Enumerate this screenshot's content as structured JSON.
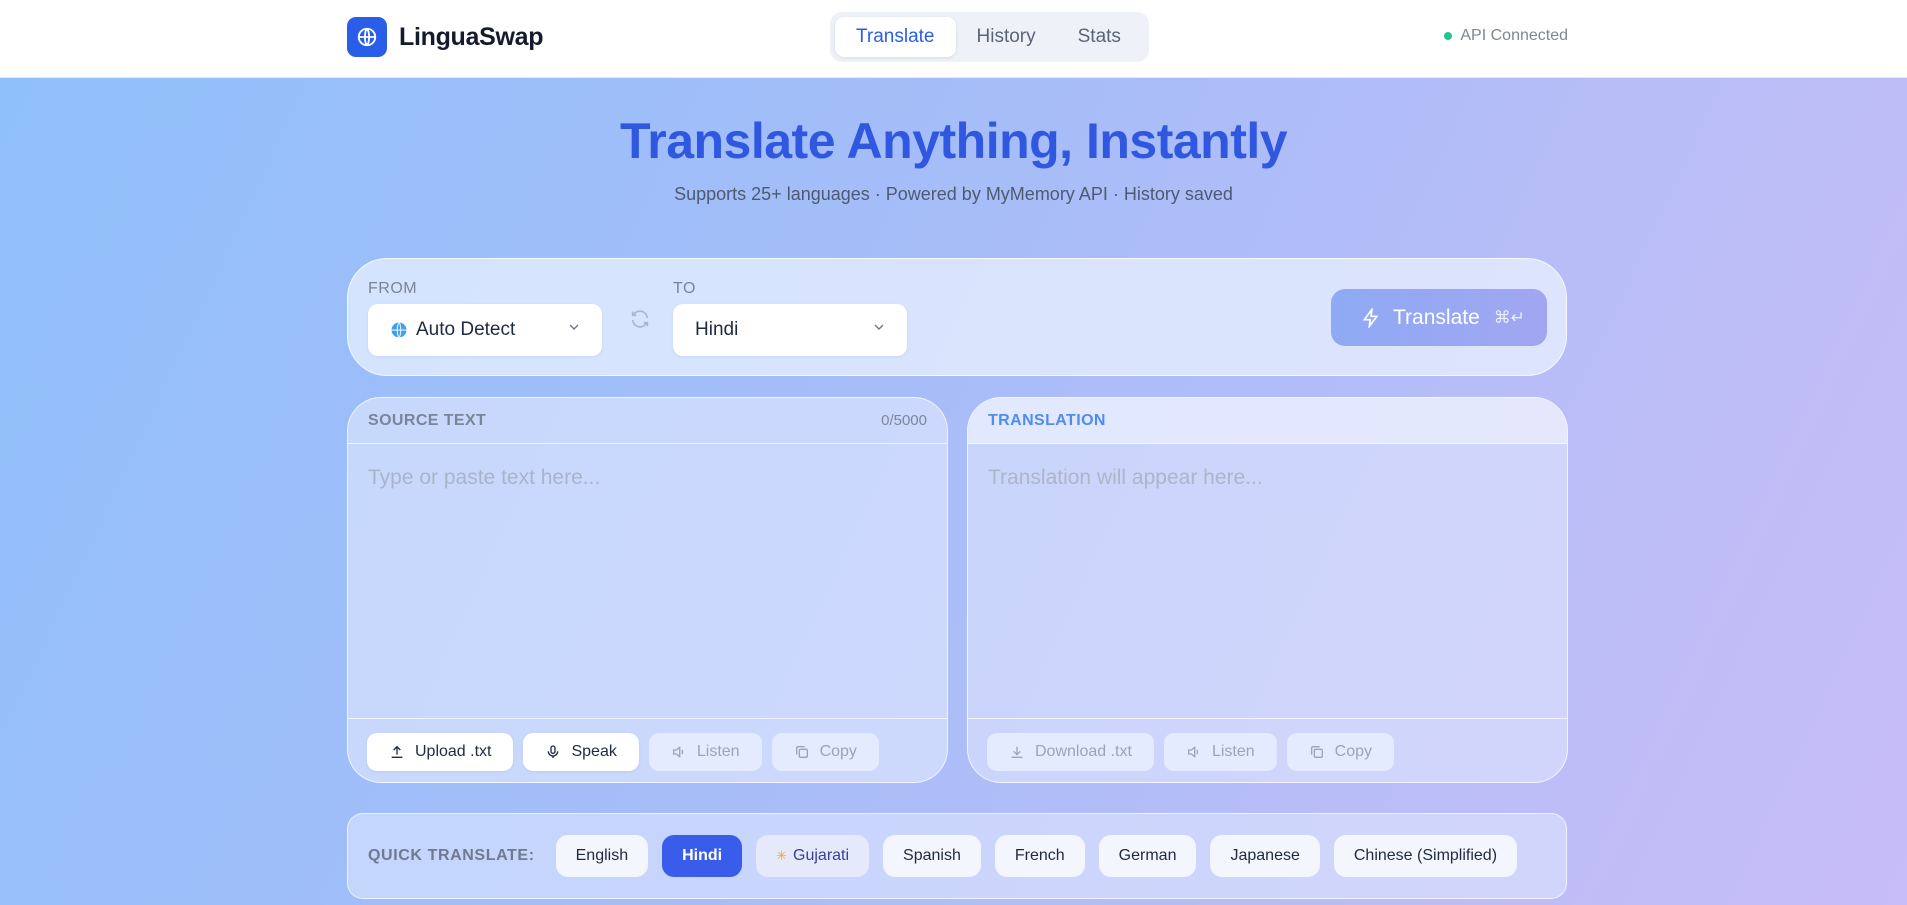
{
  "header": {
    "app_name": "LinguaSwap",
    "tabs": [
      {
        "label": "Translate",
        "active": true
      },
      {
        "label": "History",
        "active": false
      },
      {
        "label": "Stats",
        "active": false
      }
    ],
    "api_status": "API Connected",
    "status_color": "#22c58b"
  },
  "hero": {
    "title": "Translate Anything, Instantly",
    "subtitle": "Supports 25+ languages · Powered by MyMemory API · History saved"
  },
  "language_bar": {
    "from_label": "FROM",
    "from_value": "Auto Detect",
    "to_label": "TO",
    "to_value": "Hindi",
    "translate_label": "Translate",
    "shortcut": "⌘↵"
  },
  "source_panel": {
    "title": "SOURCE TEXT",
    "char_count": "0/5000",
    "placeholder": "Type or paste text here...",
    "actions": {
      "upload": "Upload .txt",
      "speak": "Speak",
      "listen": "Listen",
      "copy": "Copy"
    }
  },
  "target_panel": {
    "title": "TRANSLATION",
    "placeholder": "Translation will appear here...",
    "actions": {
      "download": "Download .txt",
      "listen": "Listen",
      "copy": "Copy"
    }
  },
  "quick_translate": {
    "label": "QUICK TRANSLATE:",
    "languages": [
      "English",
      "Hindi",
      "Gujarati",
      "Spanish",
      "French",
      "German",
      "Japanese",
      "Chinese (Simplified)"
    ],
    "selected": "Hindi",
    "suggested": "Gujarati"
  },
  "colors": {
    "accent": "#2b5ee8",
    "title": "#2f57e0",
    "active_chip": "#3a5cea"
  }
}
